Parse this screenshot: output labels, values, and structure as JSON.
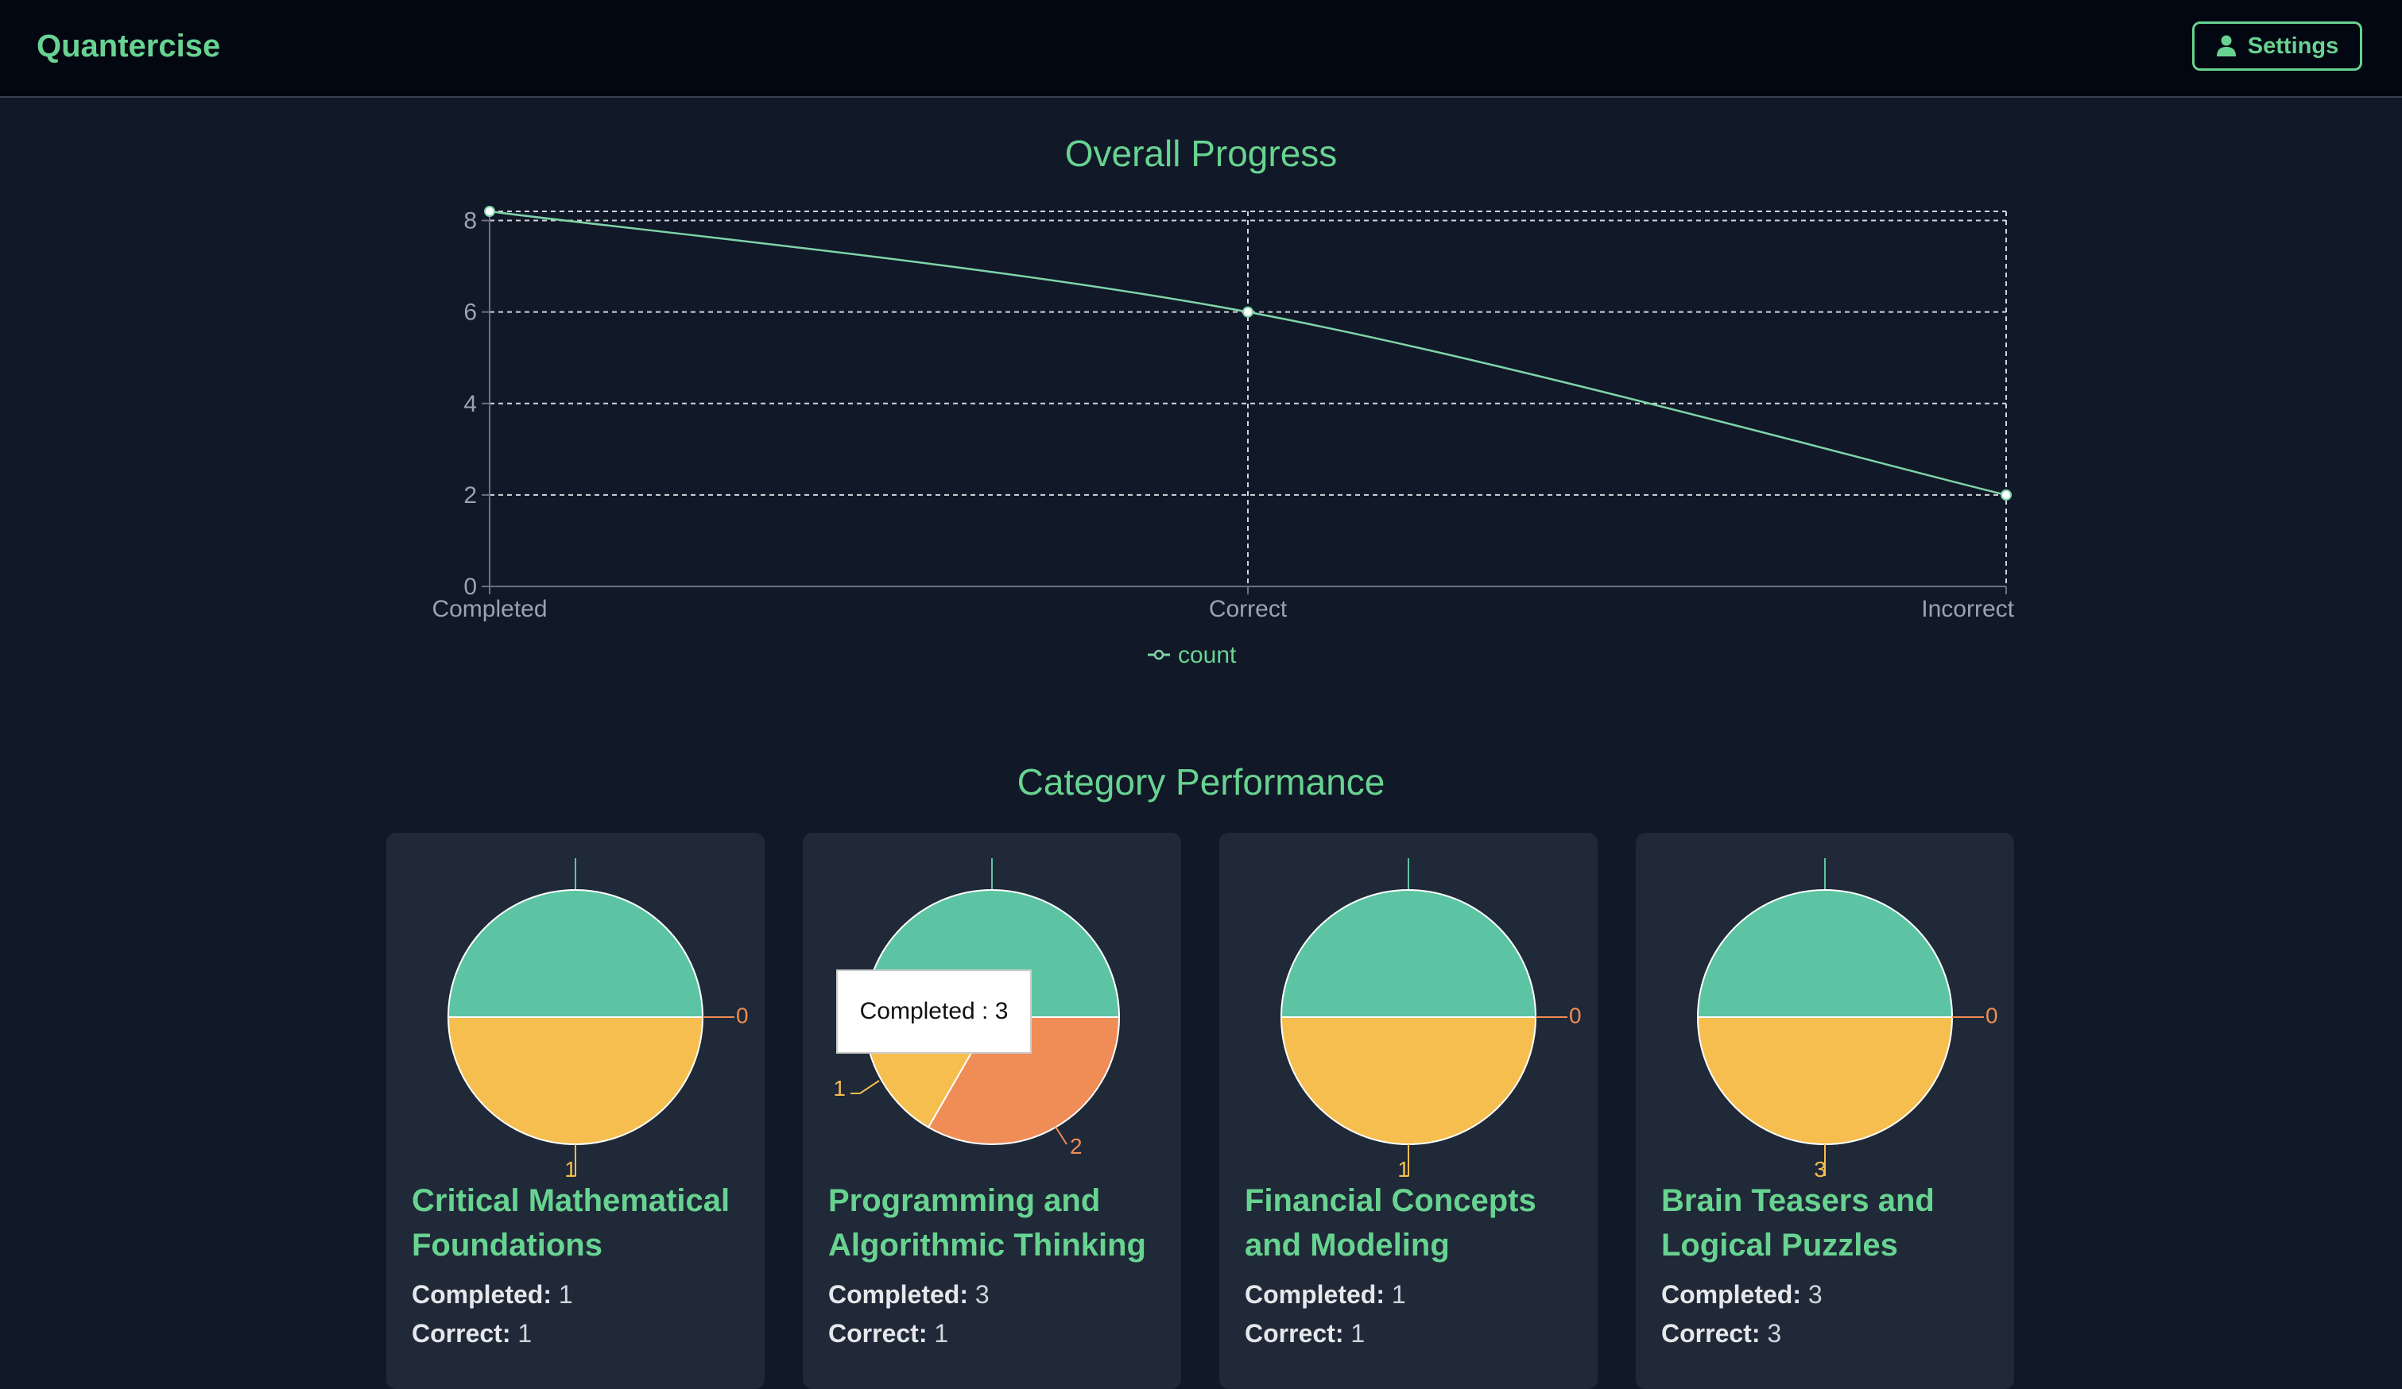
{
  "app": {
    "title": "Quantercise"
  },
  "header": {
    "settings_label": "Settings",
    "settings_icon": "user-icon"
  },
  "overall": {
    "title": "Overall Progress",
    "legend": "count"
  },
  "chart_data": {
    "type": "line",
    "title": "Overall Progress",
    "categories": [
      "Completed",
      "Correct",
      "Incorrect"
    ],
    "series": [
      {
        "name": "count",
        "values": [
          8.2,
          6,
          2
        ]
      }
    ],
    "ylim": [
      0,
      8.2
    ],
    "yticks": [
      0,
      2,
      4,
      6,
      8
    ],
    "grid": true,
    "legend": "bottom-center"
  },
  "categories_section": {
    "title": "Category Performance"
  },
  "colors": {
    "accent": "#68d391",
    "completed": "#5cc4a3",
    "correct": "#f5be4f",
    "incorrect": "#f08c55",
    "line": "#7fd4a8"
  },
  "cards": [
    {
      "title": "Critical Mathematical Foundations",
      "completed_label": "Completed:",
      "completed": "1",
      "correct_label": "Correct:",
      "correct": "1",
      "pie_labels": {
        "bottom": "1",
        "right": "0"
      }
    },
    {
      "title": "Programming and Algorithmic Thinking",
      "completed_label": "Completed:",
      "completed": "3",
      "correct_label": "Correct:",
      "correct": "1",
      "pie_labels": {
        "left": "1",
        "right": "2"
      }
    },
    {
      "title": "Financial Concepts and Modeling",
      "completed_label": "Completed:",
      "completed": "1",
      "correct_label": "Correct:",
      "correct": "1",
      "pie_labels": {
        "bottom": "1",
        "right": "0"
      }
    },
    {
      "title": "Brain Teasers and Logical Puzzles",
      "completed_label": "Completed:",
      "completed": "3",
      "correct_label": "Correct:",
      "correct": "3",
      "pie_labels": {
        "bottom": "3",
        "right": "0"
      }
    }
  ],
  "tooltip": {
    "text": "Completed : 3"
  }
}
